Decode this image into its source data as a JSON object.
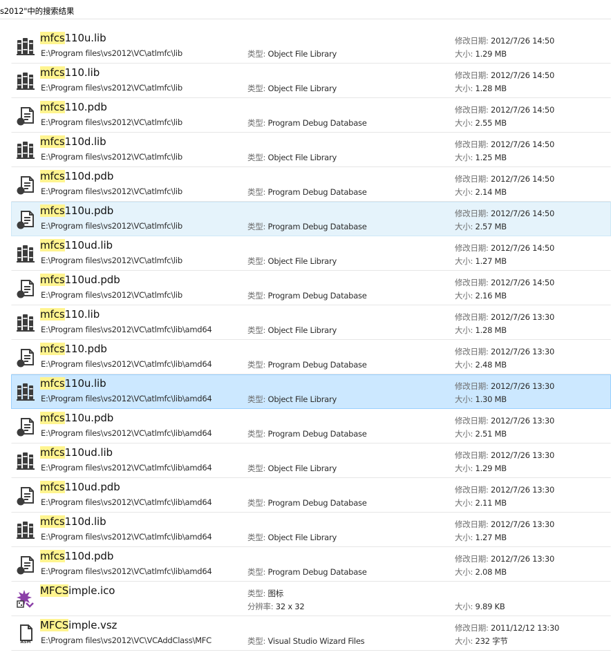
{
  "window": {
    "title": "s2012\"中的搜索结果"
  },
  "labels": {
    "type": "类型: ",
    "modified": "修改日期: ",
    "size": "大小: ",
    "resolution": "分辨率: "
  },
  "icons": {
    "lib": "library-books-icon",
    "pdb": "debug-database-icon",
    "ico": "image-icon",
    "vsz": "asm-file-icon"
  },
  "colors": {
    "highlight": "#fff48f",
    "hover": "#e5f3fb",
    "selected": "#cce8ff",
    "ico_accent": "#8b3fa8"
  },
  "results": [
    {
      "hl": "mfcs",
      "rest": "110u.lib",
      "icon": "lib",
      "path": "E:\\Program files\\vs2012\\VC\\atlmfc\\lib",
      "type": "Object File Library",
      "modified": "2012/7/26 14:50",
      "size": "1.29 MB",
      "state": ""
    },
    {
      "hl": "mfcs",
      "rest": "110.lib",
      "icon": "lib",
      "path": "E:\\Program files\\vs2012\\VC\\atlmfc\\lib",
      "type": "Object File Library",
      "modified": "2012/7/26 14:50",
      "size": "1.28 MB",
      "state": ""
    },
    {
      "hl": "mfcs",
      "rest": "110.pdb",
      "icon": "pdb",
      "path": "E:\\Program files\\vs2012\\VC\\atlmfc\\lib",
      "type": "Program Debug Database",
      "modified": "2012/7/26 14:50",
      "size": "2.55 MB",
      "state": ""
    },
    {
      "hl": "mfcs",
      "rest": "110d.lib",
      "icon": "lib",
      "path": "E:\\Program files\\vs2012\\VC\\atlmfc\\lib",
      "type": "Object File Library",
      "modified": "2012/7/26 14:50",
      "size": "1.25 MB",
      "state": ""
    },
    {
      "hl": "mfcs",
      "rest": "110d.pdb",
      "icon": "pdb",
      "path": "E:\\Program files\\vs2012\\VC\\atlmfc\\lib",
      "type": "Program Debug Database",
      "modified": "2012/7/26 14:50",
      "size": "2.14 MB",
      "state": ""
    },
    {
      "hl": "mfcs",
      "rest": "110u.pdb",
      "icon": "pdb",
      "path": "E:\\Program files\\vs2012\\VC\\atlmfc\\lib",
      "type": "Program Debug Database",
      "modified": "2012/7/26 14:50",
      "size": "2.57 MB",
      "state": "hover"
    },
    {
      "hl": "mfcs",
      "rest": "110ud.lib",
      "icon": "lib",
      "path": "E:\\Program files\\vs2012\\VC\\atlmfc\\lib",
      "type": "Object File Library",
      "modified": "2012/7/26 14:50",
      "size": "1.27 MB",
      "state": ""
    },
    {
      "hl": "mfcs",
      "rest": "110ud.pdb",
      "icon": "pdb",
      "path": "E:\\Program files\\vs2012\\VC\\atlmfc\\lib",
      "type": "Program Debug Database",
      "modified": "2012/7/26 14:50",
      "size": "2.16 MB",
      "state": ""
    },
    {
      "hl": "mfcs",
      "rest": "110.lib",
      "icon": "lib",
      "path": "E:\\Program files\\vs2012\\VC\\atlmfc\\lib\\amd64",
      "type": "Object File Library",
      "modified": "2012/7/26 13:30",
      "size": "1.28 MB",
      "state": ""
    },
    {
      "hl": "mfcs",
      "rest": "110.pdb",
      "icon": "pdb",
      "path": "E:\\Program files\\vs2012\\VC\\atlmfc\\lib\\amd64",
      "type": "Program Debug Database",
      "modified": "2012/7/26 13:30",
      "size": "2.48 MB",
      "state": ""
    },
    {
      "hl": "mfcs",
      "rest": "110u.lib",
      "icon": "lib",
      "path": "E:\\Program files\\vs2012\\VC\\atlmfc\\lib\\amd64",
      "type": "Object File Library",
      "modified": "2012/7/26 13:30",
      "size": "1.30 MB",
      "state": "selected"
    },
    {
      "hl": "mfcs",
      "rest": "110u.pdb",
      "icon": "pdb",
      "path": "E:\\Program files\\vs2012\\VC\\atlmfc\\lib\\amd64",
      "type": "Program Debug Database",
      "modified": "2012/7/26 13:30",
      "size": "2.51 MB",
      "state": ""
    },
    {
      "hl": "mfcs",
      "rest": "110ud.lib",
      "icon": "lib",
      "path": "E:\\Program files\\vs2012\\VC\\atlmfc\\lib\\amd64",
      "type": "Object File Library",
      "modified": "2012/7/26 13:30",
      "size": "1.29 MB",
      "state": ""
    },
    {
      "hl": "mfcs",
      "rest": "110ud.pdb",
      "icon": "pdb",
      "path": "E:\\Program files\\vs2012\\VC\\atlmfc\\lib\\amd64",
      "type": "Program Debug Database",
      "modified": "2012/7/26 13:30",
      "size": "2.11 MB",
      "state": ""
    },
    {
      "hl": "mfcs",
      "rest": "110d.lib",
      "icon": "lib",
      "path": "E:\\Program files\\vs2012\\VC\\atlmfc\\lib\\amd64",
      "type": "Object File Library",
      "modified": "2012/7/26 13:30",
      "size": "1.27 MB",
      "state": ""
    },
    {
      "hl": "mfcs",
      "rest": "110d.pdb",
      "icon": "pdb",
      "path": "E:\\Program files\\vs2012\\VC\\atlmfc\\lib\\amd64",
      "type": "Program Debug Database",
      "modified": "2012/7/26 13:30",
      "size": "2.08 MB",
      "state": ""
    },
    {
      "hl": "MFCS",
      "rest": "imple.ico",
      "icon": "ico",
      "path": "",
      "type": "图标",
      "resolution": "32 x 32",
      "modified": "",
      "size": "9.89 KB",
      "state": ""
    },
    {
      "hl": "MFCS",
      "rest": "imple.vsz",
      "icon": "vsz",
      "path": "E:\\Program files\\vs2012\\VC\\VCAddClass\\MFC",
      "type": "Visual Studio Wizard Files",
      "modified": "2011/12/12 13:30",
      "size": "232 字节",
      "state": ""
    }
  ]
}
